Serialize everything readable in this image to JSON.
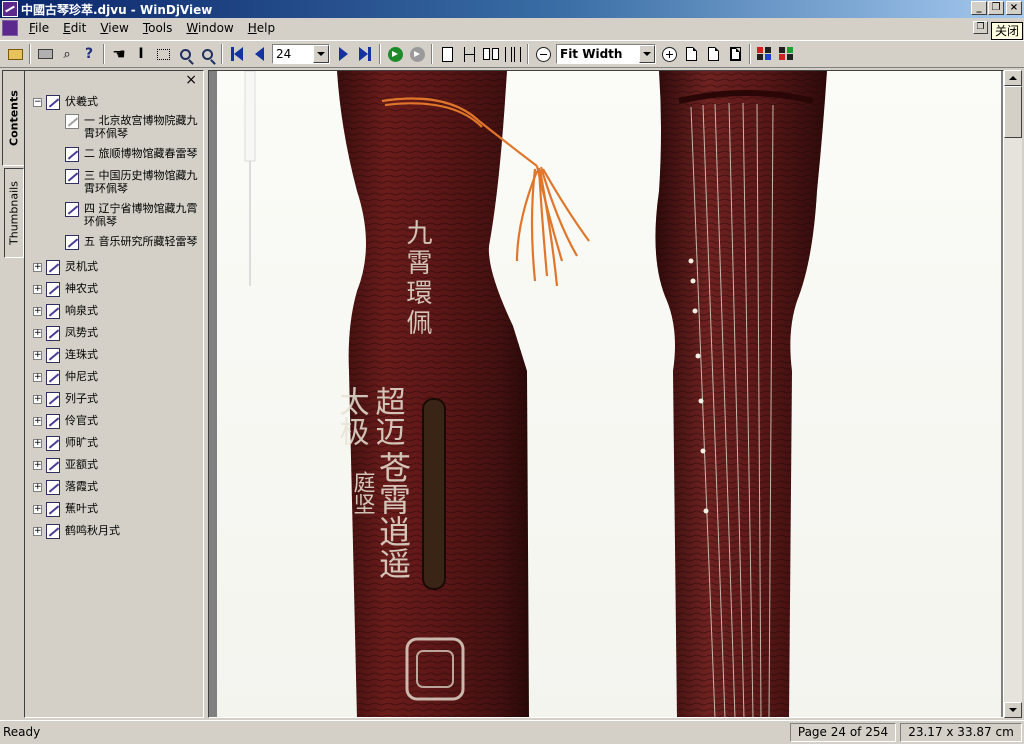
{
  "window": {
    "title": "中國古琴珍萃.djvu - WinDjView",
    "tooltip": "关闭"
  },
  "menu": {
    "items": [
      {
        "key": "F",
        "rest": "ile"
      },
      {
        "key": "E",
        "rest": "dit"
      },
      {
        "key": "V",
        "rest": "iew"
      },
      {
        "key": "T",
        "rest": "ools"
      },
      {
        "key": "W",
        "rest": "indow"
      },
      {
        "key": "H",
        "rest": "elp"
      }
    ]
  },
  "toolbar": {
    "page_number": "24",
    "zoom_mode": "Fit Width"
  },
  "sidebar": {
    "tabs": [
      "Contents",
      "Thumbnails"
    ],
    "close_glyph": "×",
    "tree": [
      {
        "label": "伏羲式",
        "expanded": true,
        "toggle": "−",
        "children": [
          "一  北京故宫博物院藏九霄环佩琴",
          "二  旅顺博物馆藏春雷琴",
          "三  中国历史博物馆藏九霄环佩琴",
          "四  辽宁省博物馆藏九霄环佩琴",
          "五  音乐研究所藏轻雷琴"
        ]
      },
      {
        "label": "灵机式",
        "toggle": "+"
      },
      {
        "label": "神农式",
        "toggle": "+"
      },
      {
        "label": "响泉式",
        "toggle": "+"
      },
      {
        "label": "凤势式",
        "toggle": "+"
      },
      {
        "label": "连珠式",
        "toggle": "+"
      },
      {
        "label": "仲尼式",
        "toggle": "+"
      },
      {
        "label": "列子式",
        "toggle": "+"
      },
      {
        "label": "伶官式",
        "toggle": "+"
      },
      {
        "label": "师旷式",
        "toggle": "+"
      },
      {
        "label": "亚额式",
        "toggle": "+"
      },
      {
        "label": "落霞式",
        "toggle": "+"
      },
      {
        "label": "蕉叶式",
        "toggle": "+"
      },
      {
        "label": "鹤鸣秋月式",
        "toggle": "+"
      }
    ]
  },
  "document": {
    "inscriptions": {
      "upper": "九霄環佩",
      "left_col1": "超迈",
      "left_col2": "太极",
      "center_col": "苍霄逍遥",
      "lower_left": "庭坚"
    }
  },
  "status": {
    "text": "Ready",
    "page": "Page 24 of 254",
    "size": "23.17 x 33.87 cm"
  },
  "colors": {
    "titlebar_start": "#0a246a",
    "titlebar_end": "#a6caf0",
    "lacquer": "#5a1818",
    "tassel": "#e0762a"
  }
}
